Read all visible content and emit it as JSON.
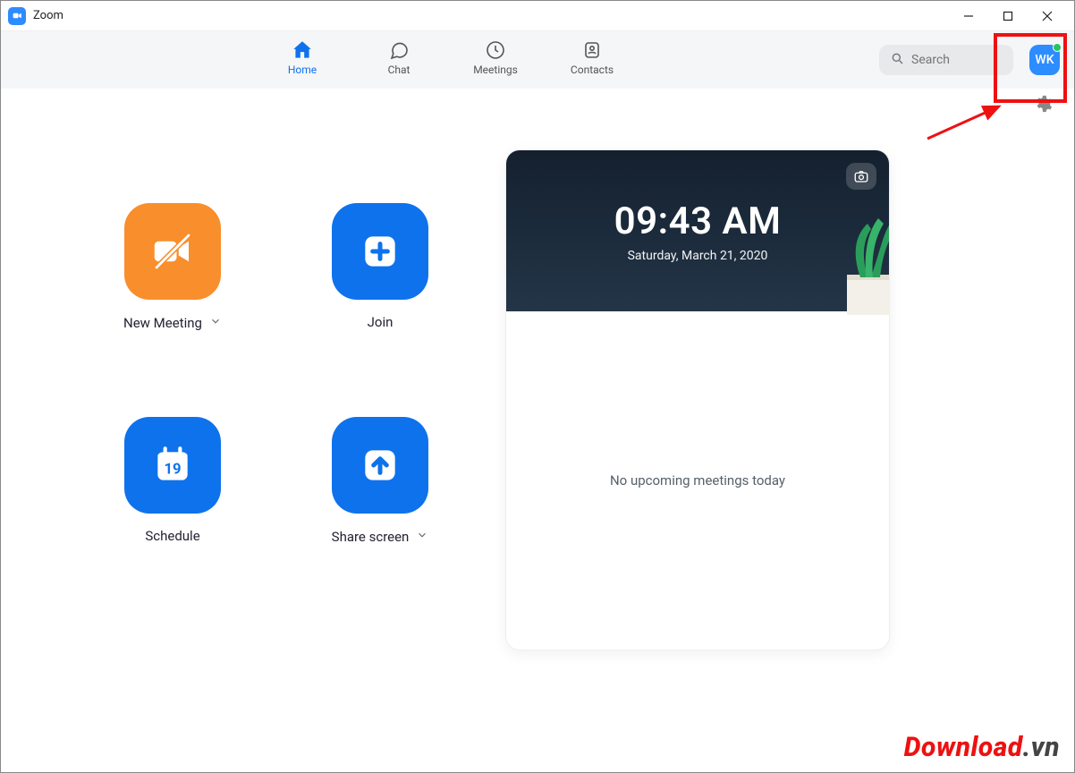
{
  "titlebar": {
    "app_name": "Zoom"
  },
  "nav": {
    "tabs": [
      {
        "label": "Home"
      },
      {
        "label": "Chat"
      },
      {
        "label": "Meetings"
      },
      {
        "label": "Contacts"
      }
    ],
    "search_placeholder": "Search",
    "avatar_initials": "WK"
  },
  "actions": {
    "new_meeting": "New Meeting",
    "join": "Join",
    "schedule": "Schedule",
    "share_screen": "Share screen",
    "calendar_day": "19"
  },
  "info_card": {
    "time": "09:43 AM",
    "date": "Saturday, March 21, 2020",
    "empty_state": "No upcoming meetings today"
  },
  "watermark": {
    "main": "Download",
    "suffix": ".vn"
  }
}
